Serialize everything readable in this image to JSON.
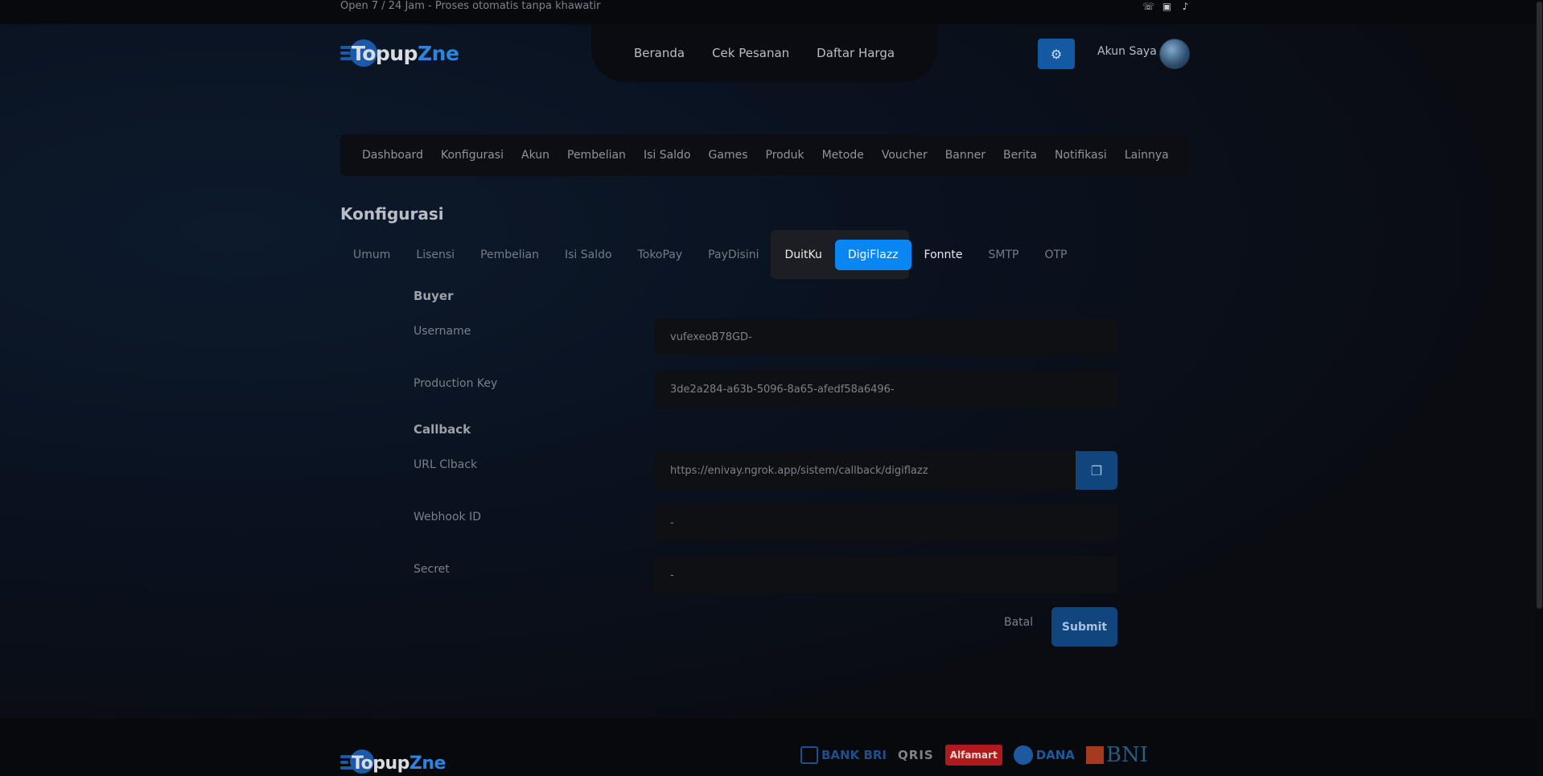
{
  "topbar": {
    "tagline": "Open 7 / 24 Jam - Proses otomatis tanpa khawatir",
    "social_icons": [
      "whatsapp-icon",
      "instagram-icon",
      "tiktok-icon"
    ]
  },
  "header": {
    "logo": {
      "part1": "Topup",
      "part2": "Z",
      "part3": "ne"
    },
    "nav": [
      "Beranda",
      "Cek Pesanan",
      "Daftar Harga"
    ],
    "account_label": "Akun Saya"
  },
  "subnav": [
    "Dashboard",
    "Konfigurasi",
    "Akun",
    "Pembelian",
    "Isi Saldo",
    "Games",
    "Produk",
    "Metode",
    "Voucher",
    "Banner",
    "Berita",
    "Notifikasi",
    "Lainnya"
  ],
  "page": {
    "title": "Konfigurasi",
    "tabs": [
      "Umum",
      "Lisensi",
      "Pembelian",
      "Isi Saldo",
      "TokoPay",
      "PayDisini",
      "DuitKu",
      "DigiFlazz",
      "Fonnte",
      "SMTP",
      "OTP"
    ],
    "active_tab": "DigiFlazz"
  },
  "form": {
    "buyer_section": "Buyer",
    "username_label": "Username",
    "username_value": "vufexeoB78GD-",
    "prodkey_label": "Production Key",
    "prodkey_value": "3de2a284-a63b-5096-8a65-afedf58a6496-",
    "callback_section": "Callback",
    "url_label": "URL Clback",
    "url_value": "https://enivay.ngrok.app/sistem/callback/digiflazz",
    "webhook_label": "Webhook ID",
    "webhook_value": "-",
    "secret_label": "Secret",
    "secret_value": "-",
    "cancel_label": "Batal",
    "submit_label": "Submit"
  },
  "footer": {
    "payments": [
      "BANK BRI",
      "QRIS",
      "Alfamart",
      "DANA",
      "BNI"
    ]
  },
  "colors": {
    "accent": "#0a86f3",
    "button": "#11457e",
    "background": "#0a0c12"
  }
}
